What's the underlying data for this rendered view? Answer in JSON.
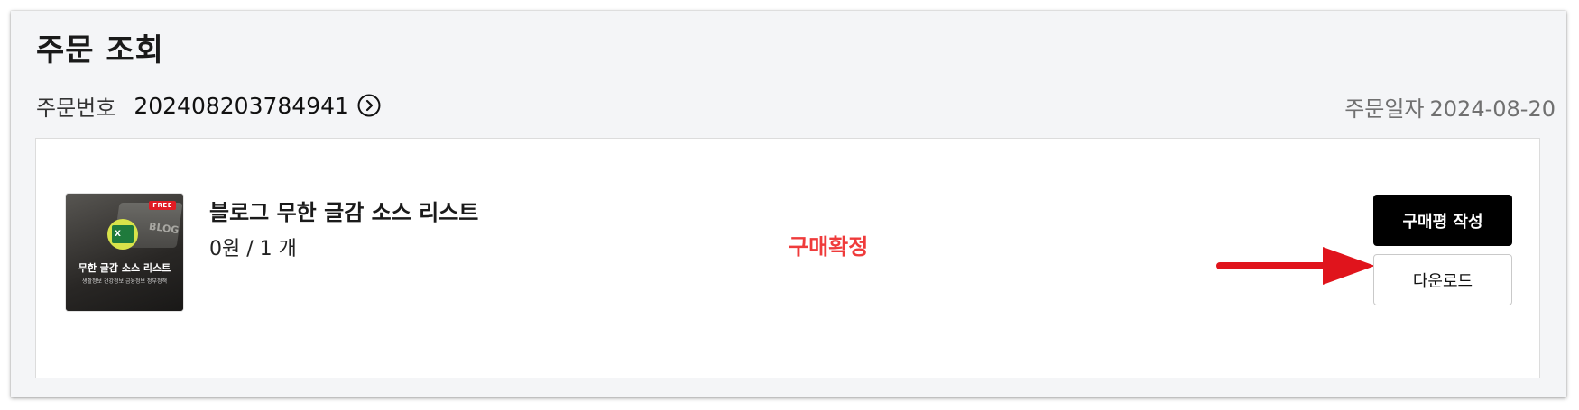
{
  "header": {
    "title": "주문 조회",
    "order_label": "주문번호",
    "order_number": "202408203784941",
    "order_date_label": "주문일자",
    "order_date": "2024-08-20"
  },
  "item": {
    "thumbnail": {
      "badge": "FREE",
      "screen_text": "BLOG",
      "icon_letter": "X",
      "title": "무한 글감 소스 리스트",
      "subtitle": "생활정보 건강정보 금융정보 정부정책"
    },
    "name": "블로그 무한 글감 소스 리스트",
    "price_qty": "0원 / 1 개",
    "status": "구매확정",
    "review_button": "구매평 작성",
    "download_button": "다운로드"
  },
  "colors": {
    "status": "#ef3b3b",
    "arrow": "#e0141c",
    "review_button_bg": "#000000",
    "panel_bg": "#f4f5f7"
  }
}
